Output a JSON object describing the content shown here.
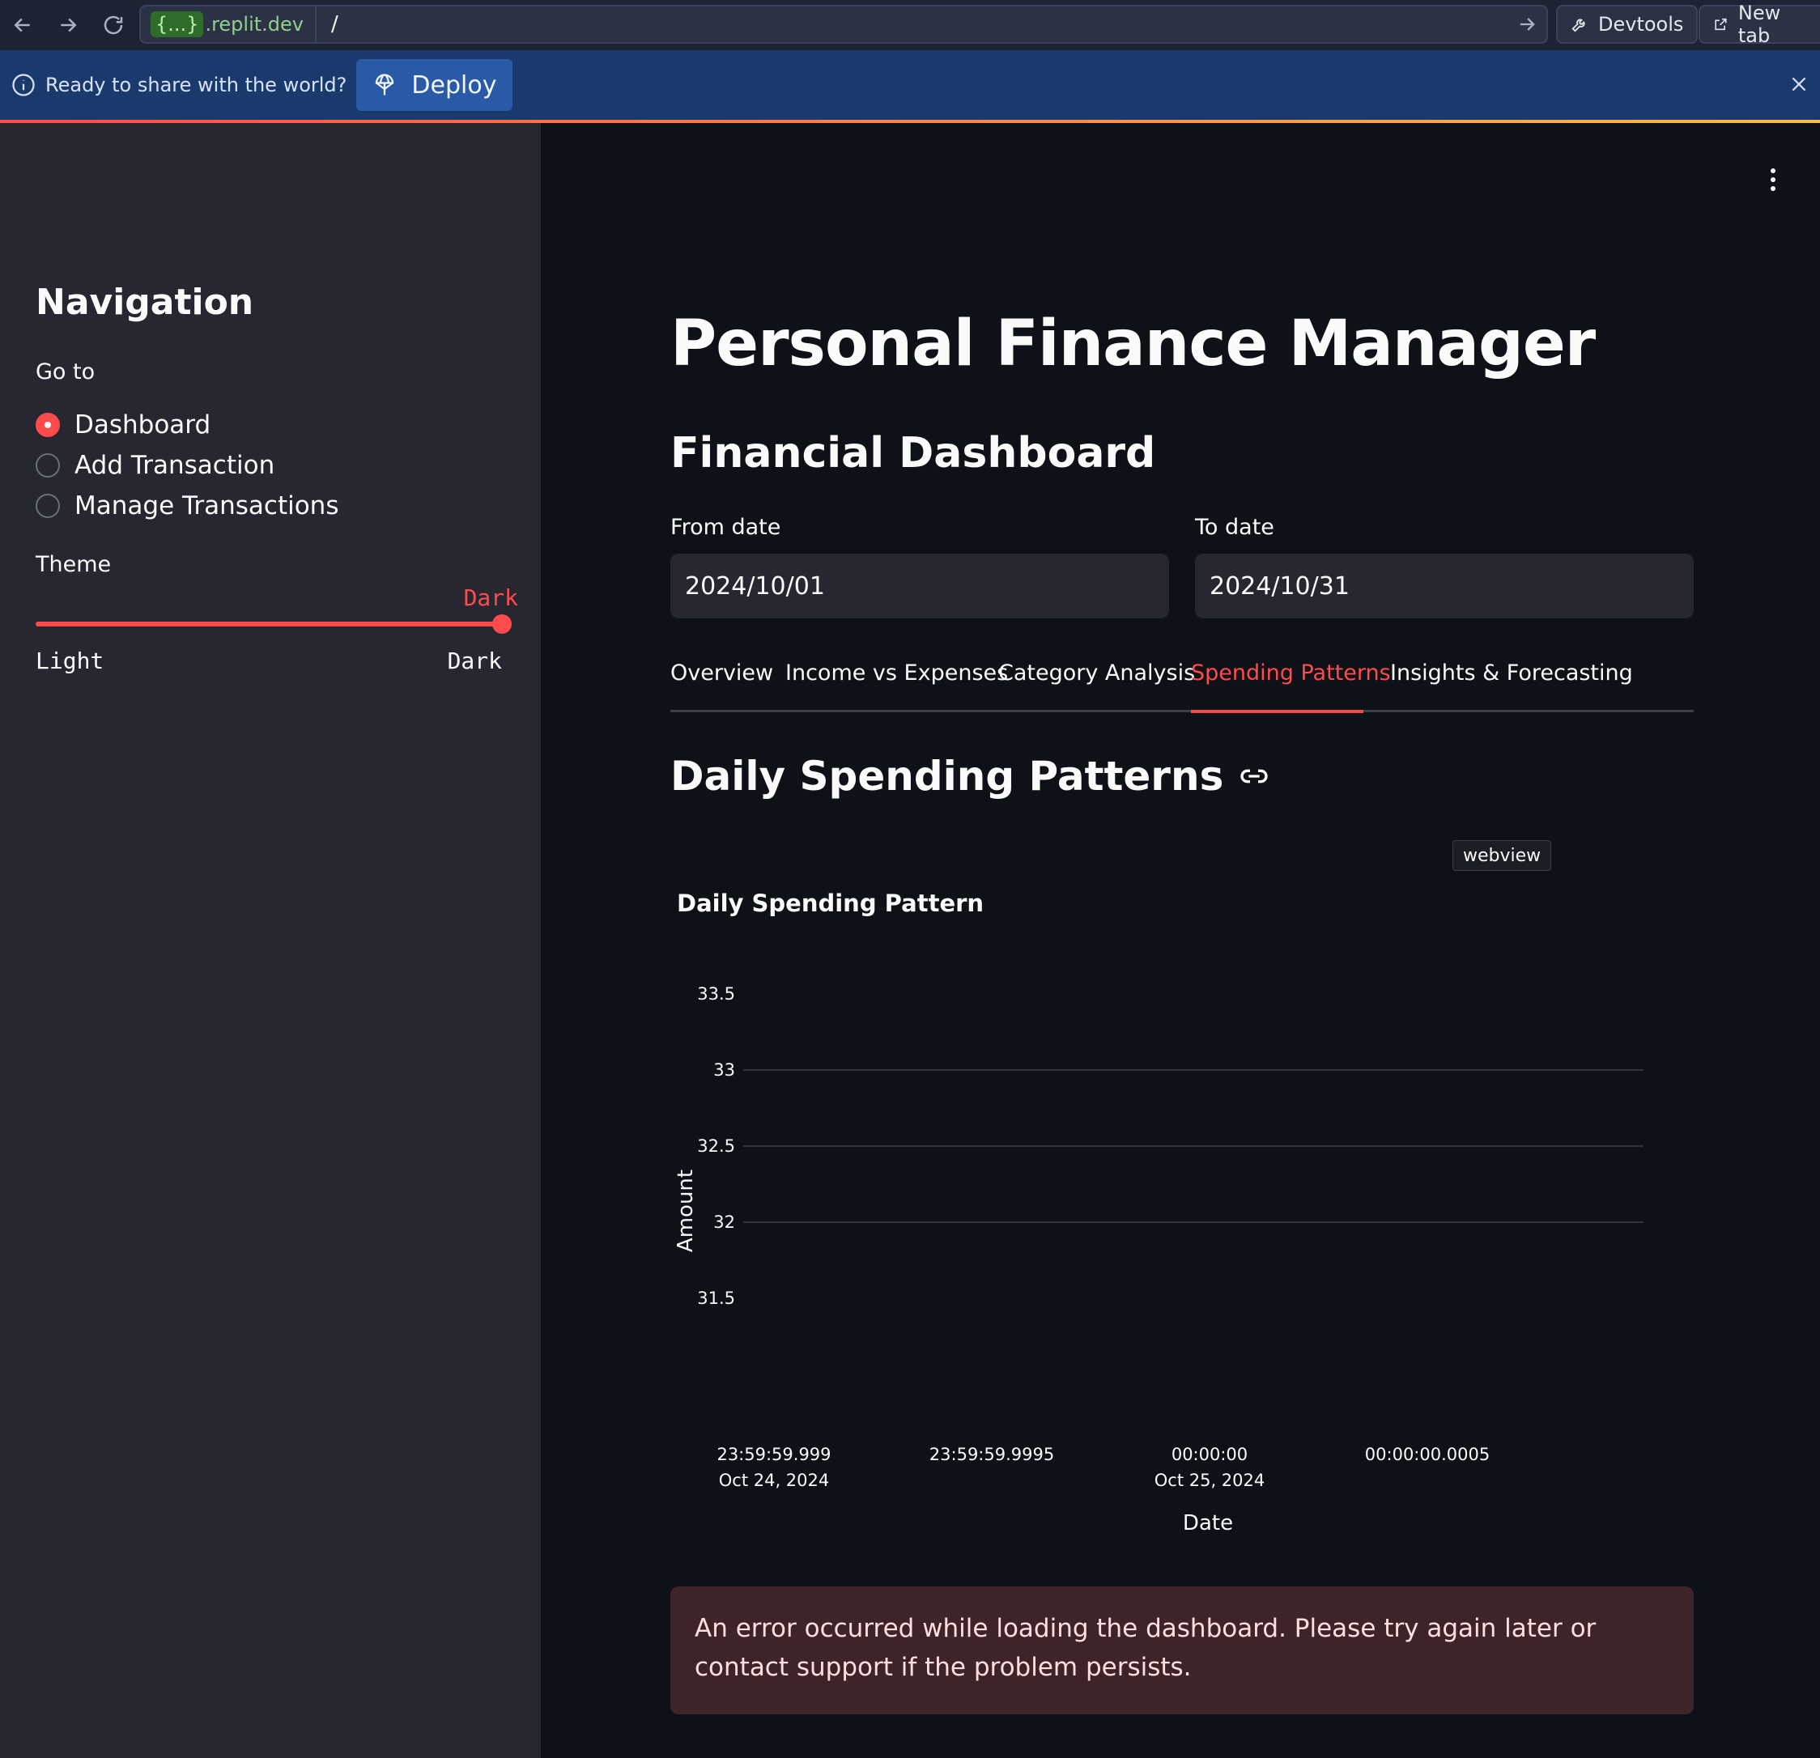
{
  "browser": {
    "host_badge": "{...}",
    "host": ".replit.dev",
    "path": "/",
    "devtools_label": "Devtools",
    "newtab_label": "New tab"
  },
  "banner": {
    "message": "Ready to share with the world?",
    "deploy_label": "Deploy"
  },
  "sidebar": {
    "title": "Navigation",
    "goto_label": "Go to",
    "options": [
      "Dashboard",
      "Add Transaction",
      "Manage Transactions"
    ],
    "selected": "Dashboard",
    "theme_label": "Theme",
    "theme_value": "Dark",
    "theme_min": "Light",
    "theme_max": "Dark"
  },
  "main": {
    "title": "Personal Finance Manager",
    "section_title": "Financial Dashboard",
    "from_label": "From date",
    "from_value": "2024/10/01",
    "to_label": "To date",
    "to_value": "2024/10/31",
    "tabs": [
      "Overview",
      "Income vs Expenses",
      "Category Analysis",
      "Spending Patterns",
      "Insights & Forecasting"
    ],
    "active_tab": "Spending Patterns",
    "subsection_title": "Daily Spending Patterns",
    "webview_badge": "webview",
    "error_message": "An error occurred while loading the dashboard. Please try again later or contact support if the problem persists."
  },
  "chart_data": {
    "type": "line",
    "title": "Daily Spending Pattern",
    "xlabel": "Date",
    "ylabel": "Amount",
    "y_ticks": [
      "33.5",
      "33",
      "32.5",
      "32",
      "31.5"
    ],
    "ylim": [
      31.5,
      33.5
    ],
    "x_ticks": [
      {
        "time": "23:59:59.999",
        "date": "Oct 24, 2024"
      },
      {
        "time": "23:59:59.9995",
        "date": ""
      },
      {
        "time": "00:00:00",
        "date": "Oct 25, 2024"
      },
      {
        "time": "00:00:00.0005",
        "date": ""
      }
    ],
    "series": [],
    "grid": true
  },
  "colors": {
    "accent": "#ff4b4b",
    "background": "#0e1117",
    "sidebar": "#262730",
    "banner": "#1a3a6e",
    "error_bg": "#3e2329"
  }
}
